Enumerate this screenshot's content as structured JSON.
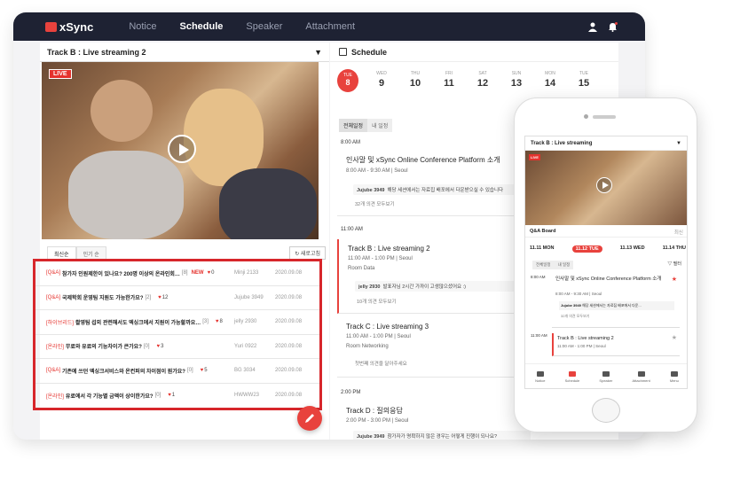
{
  "app": {
    "logo_text": "xSync",
    "nav": [
      "Notice",
      "Schedule",
      "Speaker",
      "Attachment"
    ],
    "nav_active": "Schedule"
  },
  "left_panel": {
    "track_title": "Track B : Live streaming 2",
    "live_badge": "LIVE",
    "tabs": [
      "최신순",
      "인기 순"
    ],
    "refresh_label": "새로고침",
    "questions": [
      {
        "category": "[Q&A]",
        "text": "참가자 인원제한이 있나요? 200명 이상의 온라인회…",
        "count": "[8]",
        "new": "NEW",
        "likes": "0",
        "author": "Minji 2133",
        "date": "2020.09.08"
      },
      {
        "category": "[Q&A]",
        "text": "국제학회 운영팀 지원도 가능한가요?",
        "count": "[2]",
        "new": "",
        "likes": "12",
        "author": "Jujube 3949",
        "date": "2020.09.08"
      },
      {
        "category": "[하이브리드]",
        "text": "촬영팀 섭외 관련해서도 엑싱크에서 지원이 가능할까요…",
        "count": "[3]",
        "new": "",
        "likes": "8",
        "author": "jelly 2930",
        "date": "2020.09.08"
      },
      {
        "category": "[온라인]",
        "text": "무료와 유료의 기능차이가 큰가요?",
        "count": "[0]",
        "new": "",
        "likes": "3",
        "author": "Yuri 0922",
        "date": "2020.09.08"
      },
      {
        "category": "[Q&A]",
        "text": "기존에 쓰던 엑싱크서비스와 온컨퍼의 차이점이 뭔가요?",
        "count": "[0]",
        "new": "",
        "likes": "5",
        "author": "BG 3034",
        "date": "2020.09.08"
      },
      {
        "category": "[온라인]",
        "text": "유료에서 각 기능별 금액이 상이한가요?",
        "count": "[0]",
        "new": "",
        "likes": "1",
        "author": "HWWW23",
        "date": "2020.09.08"
      }
    ]
  },
  "schedule": {
    "header": "Schedule",
    "days": [
      {
        "dow": "TUE",
        "date": "8",
        "selected": true
      },
      {
        "dow": "WED",
        "date": "9"
      },
      {
        "dow": "THU",
        "date": "10"
      },
      {
        "dow": "FRI",
        "date": "11"
      },
      {
        "dow": "SAT",
        "date": "12"
      },
      {
        "dow": "SUN",
        "date": "13"
      },
      {
        "dow": "MON",
        "date": "14"
      },
      {
        "dow": "TUE",
        "date": "15"
      }
    ],
    "filters": [
      "전체일정",
      "내 일정"
    ],
    "times": [
      "8:00 AM",
      "11:00 AM",
      "2:00 PM"
    ],
    "sessions": [
      {
        "title": "인사말 및 xSync Online Conference Platform 소개",
        "meta": "8:00 AM - 9:30 AM  |  Seoul",
        "reply_user": "Jujube 3949",
        "reply": "해당 세션에서는 자료집 배포에서 다운받으실 수 있습니다",
        "more": "32개 의견 모두보기"
      },
      {
        "title": "Track B : Live streaming 2",
        "meta": "11:00 AM - 1:00 PM  |  Seoul",
        "room": "Room Data",
        "reply_user": "jelly 2930",
        "reply": "발표자님 2시간 가까이 고생많으셨어요 :)",
        "more": "10개 의견 모두보기"
      },
      {
        "title": "Track C : Live streaming 3",
        "meta": "11:00 AM - 1:00 PM  |  Seoul",
        "room": "Room Networking",
        "more": "첫번째 의견을 달아주세요"
      },
      {
        "title": "Track D : 질의응답",
        "meta": "2:00 PM - 3:00 PM  |  Seoul",
        "reply_user": "Jujube 3949",
        "reply": "참가자가 명확하지 않은 경우는 어떻게 진행이 되나요?"
      }
    ]
  },
  "phone": {
    "track_title": "Track B : Live streaming",
    "live_badge": "LIVE",
    "qa_title": "Q&A Board",
    "qa_right": "최신",
    "days": [
      "11.11 MON",
      "11.12 TUE",
      "11.13 WED",
      "11.14 THU"
    ],
    "filters": [
      "전체일정",
      "내 일정"
    ],
    "filter_right": "필터",
    "time1": "8:00 AM",
    "session1_title": "인사말 및 xSync Online Conference Platform 소개",
    "session1_meta": "8:00 AM - 9:30 AM  |  Seoul",
    "session1_reply_user": "Jujube 3949",
    "session1_reply": "해당 세션에서는 자료집 배포에서 다운...",
    "session1_more": "32개 의견 모두보기",
    "time2": "11:00 AM",
    "session2_title": "Track B : Live streaming 2",
    "session2_meta": "11:00 AM - 1:00 PM  |  Seoul",
    "nav": [
      "Notice",
      "Schedule",
      "Speaker",
      "Attachment",
      "Menu"
    ]
  },
  "colors": {
    "accent": "#e8423d",
    "topbar": "#1e2233",
    "highlight_border": "#d7262b"
  }
}
